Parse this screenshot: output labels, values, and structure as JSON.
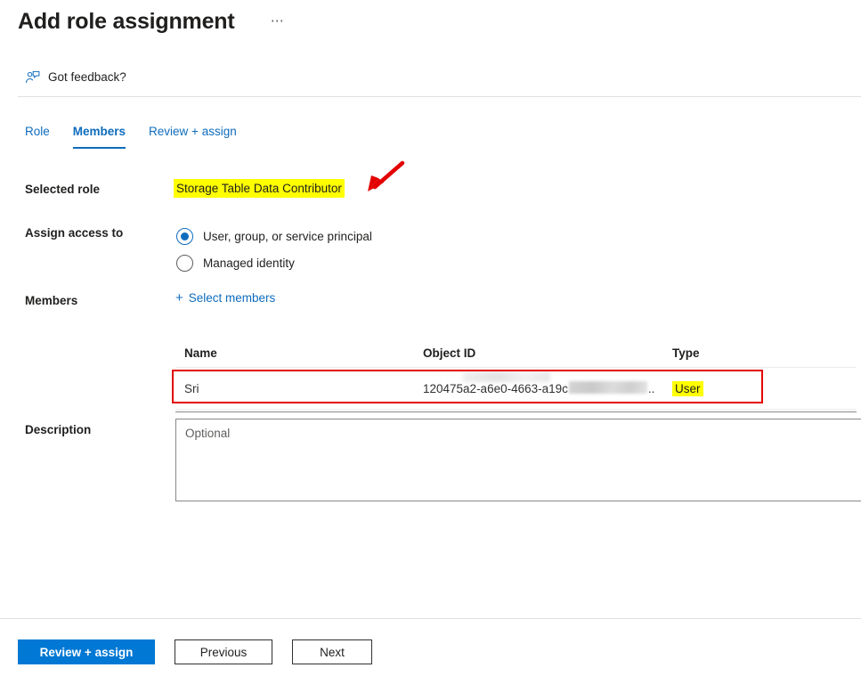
{
  "header": {
    "title": "Add role assignment",
    "more_menu": "⋯"
  },
  "feedback": {
    "icon": "feedback-person-icon",
    "label": "Got feedback?"
  },
  "tabs": [
    {
      "label": "Role",
      "active": false
    },
    {
      "label": "Members",
      "active": true
    },
    {
      "label": "Review + assign",
      "active": false
    }
  ],
  "form": {
    "selected_role": {
      "label": "Selected role",
      "value": "Storage Table Data Contributor",
      "highlight_color": "#ffff00"
    },
    "assign_access_to": {
      "label": "Assign access to",
      "options": [
        {
          "label": "User, group, or service principal",
          "selected": true
        },
        {
          "label": "Managed identity",
          "selected": false
        }
      ]
    },
    "members": {
      "label": "Members",
      "select_members_link": "Select members",
      "plus_icon": "+"
    },
    "description": {
      "label": "Description",
      "value": "",
      "placeholder": "Optional"
    }
  },
  "members_table": {
    "columns": [
      "Name",
      "Object ID",
      "Type"
    ],
    "rows": [
      {
        "name": "Sri",
        "object_id_visible": "120475a2-a6e0-4663-a19c",
        "object_id_truncation": "..",
        "type": "User",
        "type_highlight_color": "#ffff00"
      }
    ]
  },
  "annotations": {
    "arrow_color": "#e30000",
    "row_box_color": "#e30000"
  },
  "footer": {
    "primary_button": "Review + assign",
    "previous_button": "Previous",
    "next_button": "Next",
    "primary_color": "#0078d4"
  }
}
